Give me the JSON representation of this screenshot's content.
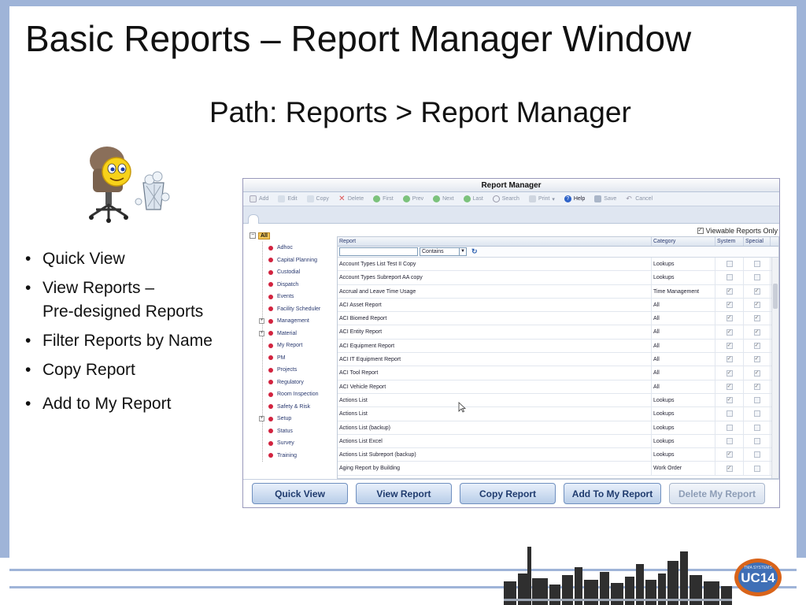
{
  "slide": {
    "title": "Basic Reports – Report Manager Window",
    "subtitle": "Path: Reports > Report Manager",
    "bullets": [
      "Quick View",
      "View Reports –",
      "Pre-designed Reports",
      "Filter Reports by Name",
      "Copy Report",
      "Add to My Report"
    ]
  },
  "window": {
    "title": "Report Manager",
    "toolbar": [
      {
        "label": "Add",
        "icon": "add-icon"
      },
      {
        "label": "Edit",
        "icon": "edit-icon"
      },
      {
        "label": "Copy",
        "icon": "copy-icon"
      },
      {
        "label": "Delete",
        "icon": "delete-icon"
      },
      {
        "label": "First",
        "icon": "first-icon"
      },
      {
        "label": "Prev",
        "icon": "prev-icon"
      },
      {
        "label": "Next",
        "icon": "next-icon"
      },
      {
        "label": "Last",
        "icon": "last-icon"
      },
      {
        "label": "Search",
        "icon": "search-icon"
      },
      {
        "label": "Print",
        "icon": "print-icon"
      },
      {
        "label": "Help",
        "icon": "help-icon"
      },
      {
        "label": "Save",
        "icon": "save-icon"
      },
      {
        "label": "Cancel",
        "icon": "cancel-icon"
      }
    ],
    "viewable_only_label": "Viewable Reports Only",
    "viewable_only_checked": true,
    "tree": {
      "root_label": "All",
      "items": [
        {
          "label": "Adhoc",
          "expandable": false
        },
        {
          "label": "Capital Planning",
          "expandable": false
        },
        {
          "label": "Custodial",
          "expandable": false
        },
        {
          "label": "Dispatch",
          "expandable": false
        },
        {
          "label": "Events",
          "expandable": false
        },
        {
          "label": "Facility Scheduler",
          "expandable": false
        },
        {
          "label": "Management",
          "expandable": true
        },
        {
          "label": "Material",
          "expandable": true
        },
        {
          "label": "My Report",
          "expandable": false
        },
        {
          "label": "PM",
          "expandable": false
        },
        {
          "label": "Projects",
          "expandable": false
        },
        {
          "label": "Regulatory",
          "expandable": false
        },
        {
          "label": "Room Inspection",
          "expandable": false
        },
        {
          "label": "Safety & Risk",
          "expandable": false
        },
        {
          "label": "Setup",
          "expandable": true
        },
        {
          "label": "Status",
          "expandable": false
        },
        {
          "label": "Survey",
          "expandable": false
        },
        {
          "label": "Training",
          "expandable": false
        }
      ]
    },
    "grid": {
      "columns": [
        "Report",
        "Category",
        "System",
        "Special"
      ],
      "filter_value": "",
      "filter_operator": "Contains",
      "rows": [
        {
          "report": "Account Types List Test II Copy",
          "category": "Lookups",
          "system": false,
          "special": false
        },
        {
          "report": "Account Types Subreport AA copy",
          "category": "Lookups",
          "system": false,
          "special": false
        },
        {
          "report": "Accrual and Leave Time Usage",
          "category": "Time Management",
          "system": true,
          "special": true
        },
        {
          "report": "ACI Asset Report",
          "category": "All",
          "system": true,
          "special": true
        },
        {
          "report": "ACI Biomed Report",
          "category": "All",
          "system": true,
          "special": true
        },
        {
          "report": "ACI Entity Report",
          "category": "All",
          "system": true,
          "special": true
        },
        {
          "report": "ACI Equipment Report",
          "category": "All",
          "system": true,
          "special": true
        },
        {
          "report": "ACI IT Equipment Report",
          "category": "All",
          "system": true,
          "special": true
        },
        {
          "report": "ACI Tool Report",
          "category": "All",
          "system": true,
          "special": true
        },
        {
          "report": "ACI Vehicle Report",
          "category": "All",
          "system": true,
          "special": true
        },
        {
          "report": "Actions List",
          "category": "Lookups",
          "system": true,
          "special": false
        },
        {
          "report": "Actions List",
          "category": "Lookups",
          "system": false,
          "special": false
        },
        {
          "report": "Actions List (backup)",
          "category": "Lookups",
          "system": false,
          "special": false
        },
        {
          "report": "Actions List Excel",
          "category": "Lookups",
          "system": false,
          "special": false
        },
        {
          "report": "Actions List Subreport (backup)",
          "category": "Lookups",
          "system": true,
          "special": false
        },
        {
          "report": "Aging Report by Building",
          "category": "Work Order",
          "system": true,
          "special": false
        }
      ]
    },
    "buttons": [
      {
        "label": "Quick View",
        "enabled": true
      },
      {
        "label": "View Report",
        "enabled": true
      },
      {
        "label": "Copy Report",
        "enabled": true
      },
      {
        "label": "Add To My Report",
        "enabled": true
      },
      {
        "label": "Delete My Report",
        "enabled": false
      }
    ]
  },
  "footer": {
    "logo_text": "UC14",
    "logo_subtext": "TMA SYSTEMS"
  },
  "colors": {
    "frame": "#9fb4d8",
    "button_text": "#1f3b6e",
    "tree_dot": "#d2233f"
  }
}
